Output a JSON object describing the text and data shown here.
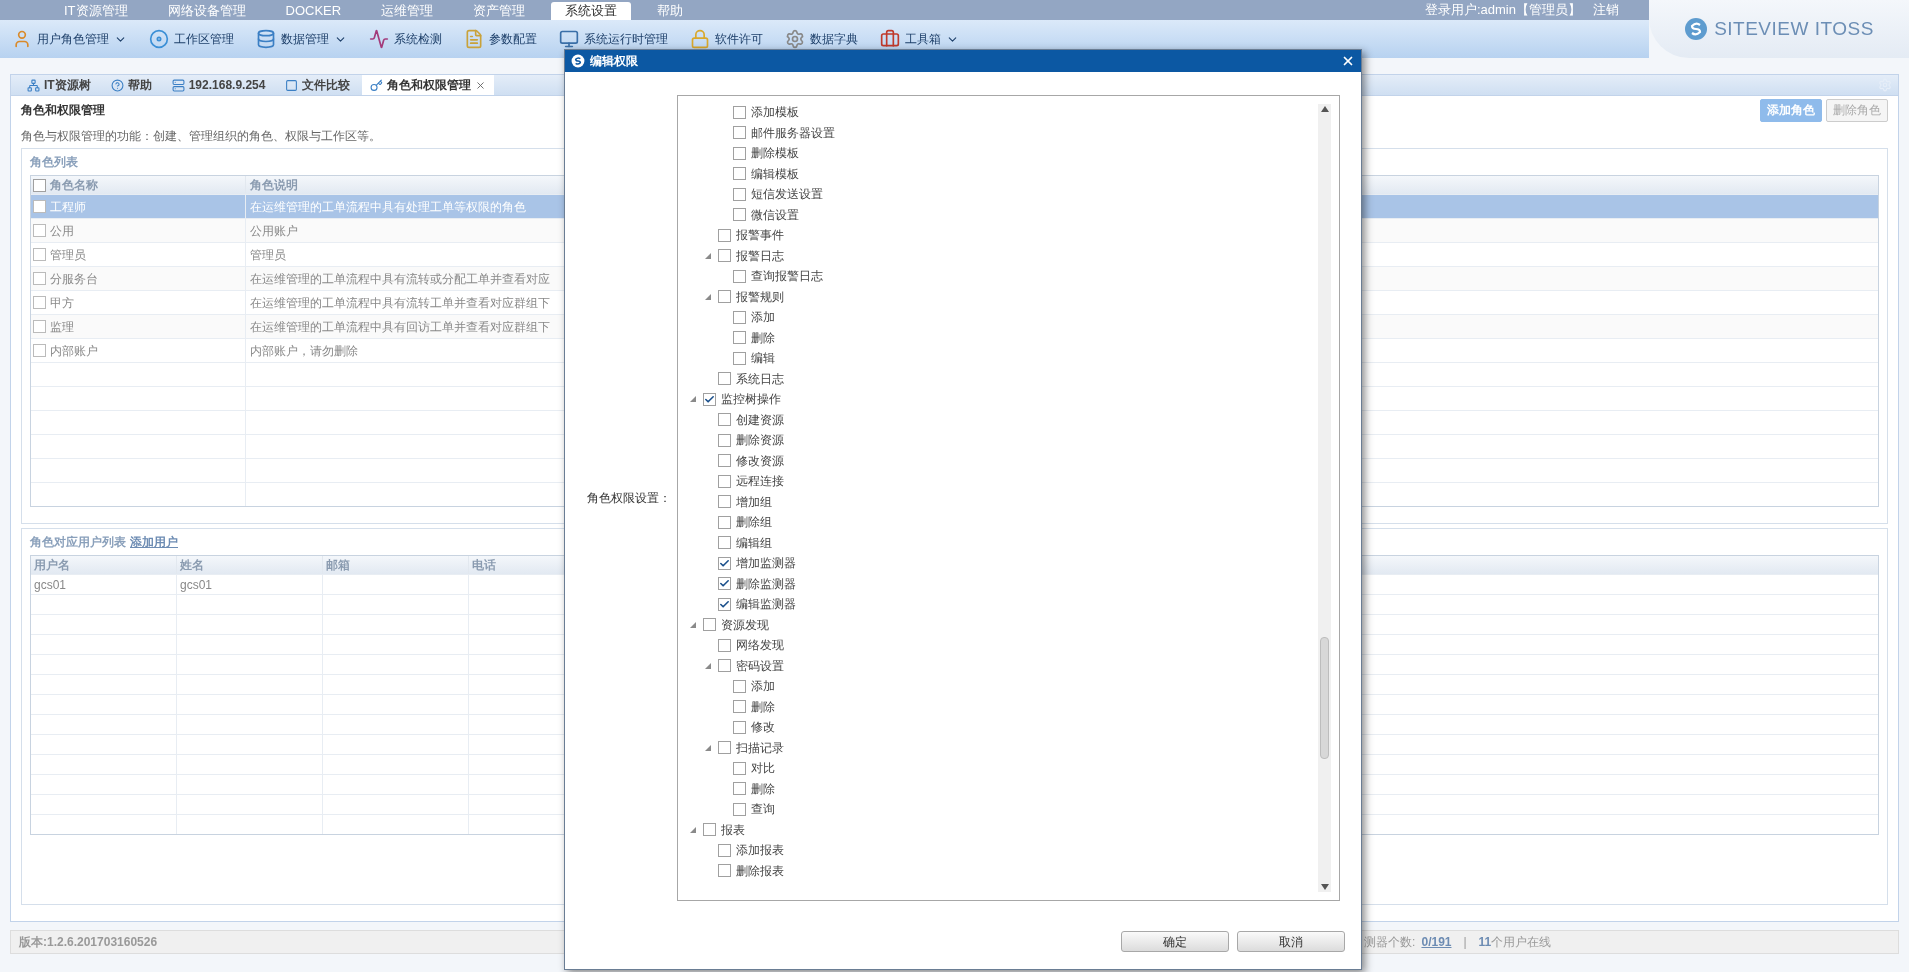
{
  "top_menu": [
    {
      "label": "IT资源管理",
      "selected": false
    },
    {
      "label": "网络设备管理",
      "selected": false
    },
    {
      "label": "DOCKER",
      "selected": false
    },
    {
      "label": "运维管理",
      "selected": false
    },
    {
      "label": "资产管理",
      "selected": false
    },
    {
      "label": "系统设置",
      "selected": true
    },
    {
      "label": "帮助",
      "selected": false
    }
  ],
  "login": {
    "user": "登录用户:admin【管理员】",
    "logout": "注销"
  },
  "logo": "SITEVIEW ITOSS",
  "toolbar": [
    {
      "label": "用户角色管理",
      "dropdown": true
    },
    {
      "label": "工作区管理",
      "dropdown": false
    },
    {
      "label": "数据管理",
      "dropdown": true
    },
    {
      "label": "系统检测",
      "dropdown": false
    },
    {
      "label": "参数配置",
      "dropdown": false
    },
    {
      "label": "系统运行时管理",
      "dropdown": false
    },
    {
      "label": "软件许可",
      "dropdown": false
    },
    {
      "label": "数据字典",
      "dropdown": false
    },
    {
      "label": "工具箱",
      "dropdown": true
    }
  ],
  "tabs": [
    {
      "label": "IT资源树",
      "selected": false,
      "closable": false
    },
    {
      "label": "帮助",
      "selected": false,
      "closable": false
    },
    {
      "label": "192.168.9.254",
      "selected": false,
      "closable": false
    },
    {
      "label": "文件比较",
      "selected": false,
      "closable": false
    },
    {
      "label": "角色和权限管理",
      "selected": true,
      "closable": true
    }
  ],
  "page": {
    "title": "角色和权限管理",
    "description": "角色与权限管理的功能：创建、管理组织的角色、权限与工作区等。",
    "buttons": [
      {
        "label": "添加角色",
        "disabled": false
      },
      {
        "label": "删除角色",
        "disabled": true
      }
    ]
  },
  "roles": {
    "title": "角色列表",
    "columns": [
      "角色名称",
      "角色说明"
    ],
    "all_checked": false,
    "rows": [
      {
        "name": "工程师",
        "description": "在运维管理的工单流程中具有处理工单等权限的角色",
        "selected": true
      },
      {
        "name": "公用",
        "description": "公用账户",
        "selected": false
      },
      {
        "name": "管理员",
        "description": "管理员",
        "selected": false
      },
      {
        "name": "分服务台",
        "description": "在运维管理的工单流程中具有流转或分配工单并查看对应",
        "selected": false
      },
      {
        "name": "甲方",
        "description": "在运维管理的工单流程中具有流转工单并查看对应群组下",
        "selected": false
      },
      {
        "name": "监理",
        "description": "在运维管理的工单流程中具有回访工单并查看对应群组下",
        "selected": false
      },
      {
        "name": "内部账户",
        "description": "内部账户，请勿删除",
        "selected": false
      }
    ]
  },
  "users": {
    "title": "角色对应用户列表",
    "add_link": "添加用户",
    "columns": [
      "用户名",
      "姓名",
      "邮箱",
      "电话"
    ],
    "rows": [
      {
        "username": "gcs01",
        "name": "gcs01"
      }
    ]
  },
  "status_bar": {
    "version": "版本:1.2.6.201703160526",
    "monitor_label": "测器个数:",
    "monitor_count": "0/191",
    "separator": "|",
    "online_count": "11",
    "online_label": "个用户在线"
  },
  "dialog": {
    "title": "编辑权限",
    "field_label": "角色权限设置：",
    "buttons": [
      "确定",
      "取消"
    ],
    "tree": [
      {
        "children": [
          {
            "children": [
              {
                "label": "添加模板",
                "checked": false
              },
              {
                "label": "邮件服务器设置",
                "checked": false
              },
              {
                "label": "删除模板",
                "checked": false
              },
              {
                "label": "编辑模板",
                "checked": false
              },
              {
                "label": "短信发送设置",
                "checked": false
              },
              {
                "label": "微信设置",
                "checked": false
              }
            ]
          },
          {
            "label": "报警事件",
            "checked": false
          },
          {
            "label": "报警日志",
            "checked": false,
            "expanded": true,
            "children": [
              {
                "label": "查询报警日志",
                "checked": false
              }
            ]
          },
          {
            "label": "报警规则",
            "checked": false,
            "expanded": true,
            "children": [
              {
                "label": "添加",
                "checked": false
              },
              {
                "label": "删除",
                "checked": false
              },
              {
                "label": "编辑",
                "checked": false
              }
            ]
          },
          {
            "label": "系统日志",
            "checked": false
          }
        ]
      },
      {
        "label": "监控树操作",
        "checked": true,
        "expanded": true,
        "children": [
          {
            "label": "创建资源",
            "checked": false
          },
          {
            "label": "删除资源",
            "checked": false
          },
          {
            "label": "修改资源",
            "checked": false
          },
          {
            "label": "远程连接",
            "checked": false
          },
          {
            "label": "增加组",
            "checked": false
          },
          {
            "label": "删除组",
            "checked": false
          },
          {
            "label": "编辑组",
            "checked": false
          },
          {
            "label": "增加监测器",
            "checked": true
          },
          {
            "label": "删除监测器",
            "checked": true
          },
          {
            "label": "编辑监测器",
            "checked": true
          }
        ]
      },
      {
        "label": "资源发现",
        "checked": false,
        "expanded": true,
        "children": [
          {
            "label": "网络发现",
            "checked": false
          },
          {
            "label": "密码设置",
            "checked": false,
            "expanded": true,
            "children": [
              {
                "label": "添加",
                "checked": false
              },
              {
                "label": "删除",
                "checked": false
              },
              {
                "label": "修改",
                "checked": false
              }
            ]
          },
          {
            "label": "扫描记录",
            "checked": false,
            "expanded": true,
            "children": [
              {
                "label": "对比",
                "checked": false
              },
              {
                "label": "删除",
                "checked": false
              },
              {
                "label": "查询",
                "checked": false
              }
            ]
          }
        ]
      },
      {
        "label": "报表",
        "checked": false,
        "expanded": true,
        "children": [
          {
            "label": "添加报表",
            "checked": false
          },
          {
            "label": "删除报表",
            "checked": false
          }
        ]
      }
    ]
  }
}
